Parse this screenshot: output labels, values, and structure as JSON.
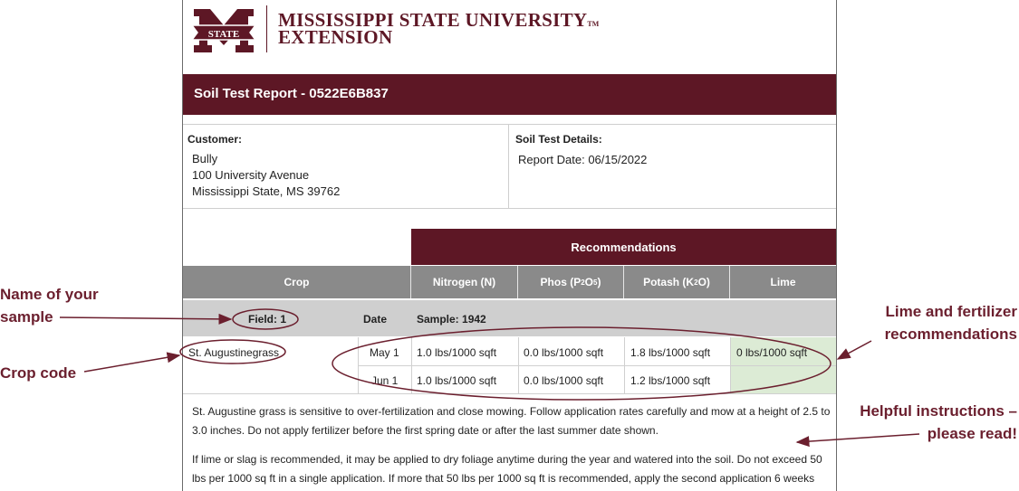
{
  "logo": {
    "emblem_text": "STATE",
    "line1": "MISSISSIPPI STATE UNIVERSITY",
    "tm": "TM",
    "line2": "EXTENSION"
  },
  "report_title": "Soil Test Report - 0522E6B837",
  "customer": {
    "label": "Customer:",
    "name": "Bully",
    "address1": "100 University Avenue",
    "address2": "Mississippi State, MS 39762"
  },
  "details": {
    "label": "Soil Test Details:",
    "report_date": "Report Date: 06/15/2022"
  },
  "recommendations_header": "Recommendations",
  "columns": {
    "crop": "Crop",
    "nitrogen": "Nitrogen (N)",
    "phos_pre": "Phos (P",
    "phos_s1": "2",
    "phos_mid": "O",
    "phos_s2": "5",
    "phos_post": ")",
    "potash_pre": "Potash (K",
    "potash_s1": "2",
    "potash_post": "O)",
    "lime": "Lime"
  },
  "field_row": {
    "field": "Field: 1",
    "date": "Date",
    "sample": "Sample: 1942"
  },
  "rows": [
    {
      "crop": "St. Augustinegrass",
      "date": "May 1",
      "nitrogen": "1.0 lbs/1000 sqft",
      "phos": "0.0 lbs/1000 sqft",
      "potash": "1.8 lbs/1000 sqft",
      "lime": "0 lbs/1000 sqft"
    },
    {
      "crop": "",
      "date": "Jun 1",
      "nitrogen": "1.0 lbs/1000 sqft",
      "phos": "0.0 lbs/1000 sqft",
      "potash": "1.2 lbs/1000 sqft",
      "lime": ""
    }
  ],
  "instructions": {
    "p1_line1": "St. Augustine grass is sensitive to over-fertilization and close mowing. Follow application rates carefully and mow at a height of 2.5 to",
    "p1_line2": "3.0 inches. Do not apply fertilizer before the first spring date or after the last summer date shown.",
    "p2_line1": "If lime or slag is recommended, it may be applied to dry foliage anytime during the year and watered into the soil. Do not exceed 50",
    "p2_line2": "lbs per 1000 sq ft in a single application. If more that 50 lbs per 1000 sq ft is recommended, apply the second application 6 weeks"
  },
  "annotations": {
    "sample_name_line1": "Name of your",
    "sample_name_line2": "sample",
    "crop_code": "Crop code",
    "lime_fert_line1": "Lime and fertilizer",
    "lime_fert_line2": "recommendations",
    "helpful_line1": "Helpful instructions –",
    "helpful_line2": "please read!"
  },
  "colors": {
    "maroon": "#5d1725",
    "header_gray": "#8a8a8a",
    "row_gray": "#cfcfcf",
    "lime_green": "#dcebd5",
    "annotation": "#6b1f2e"
  }
}
